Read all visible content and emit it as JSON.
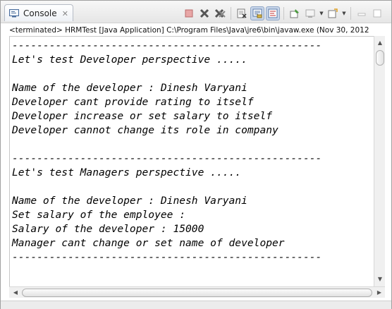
{
  "tab": {
    "label": "Console",
    "icon": "console-icon",
    "close_glyph": "✕"
  },
  "toolbar": {
    "buttons": [
      {
        "name": "terminate-icon"
      },
      {
        "name": "remove-launch-icon"
      },
      {
        "name": "remove-all-terminated-icon"
      },
      {
        "name": "clear-console-icon"
      },
      {
        "name": "scroll-lock-icon",
        "pressed": true
      },
      {
        "name": "word-wrap-icon",
        "pressed": true
      },
      {
        "name": "pin-console-icon"
      },
      {
        "name": "display-selected-console-icon"
      },
      {
        "name": "open-console-icon"
      },
      {
        "name": "minimize-icon"
      },
      {
        "name": "maximize-icon"
      }
    ]
  },
  "status_line": "<terminated> HRMTest [Java Application] C:\\Program Files\\Java\\jre6\\bin\\javaw.exe (Nov 30, 2012",
  "console_lines": [
    "--------------------------------------------------",
    "Let's test Developer perspective .....",
    "",
    "Name of the developer : Dinesh Varyani",
    "Developer cant provide rating to itself",
    "Developer increase or set salary to itself",
    "Developer cannot change its role in company",
    "",
    "--------------------------------------------------",
    "Let's test Managers perspective .....",
    "",
    "Name of the developer : Dinesh Varyani",
    "Set salary of the employee :",
    "Salary of the developer : 15000",
    "Manager cant change or set name of developer",
    "--------------------------------------------------"
  ],
  "scrollbars": {
    "up_glyph": "▲",
    "down_glyph": "▼",
    "left_glyph": "◀",
    "right_glyph": "▶"
  }
}
